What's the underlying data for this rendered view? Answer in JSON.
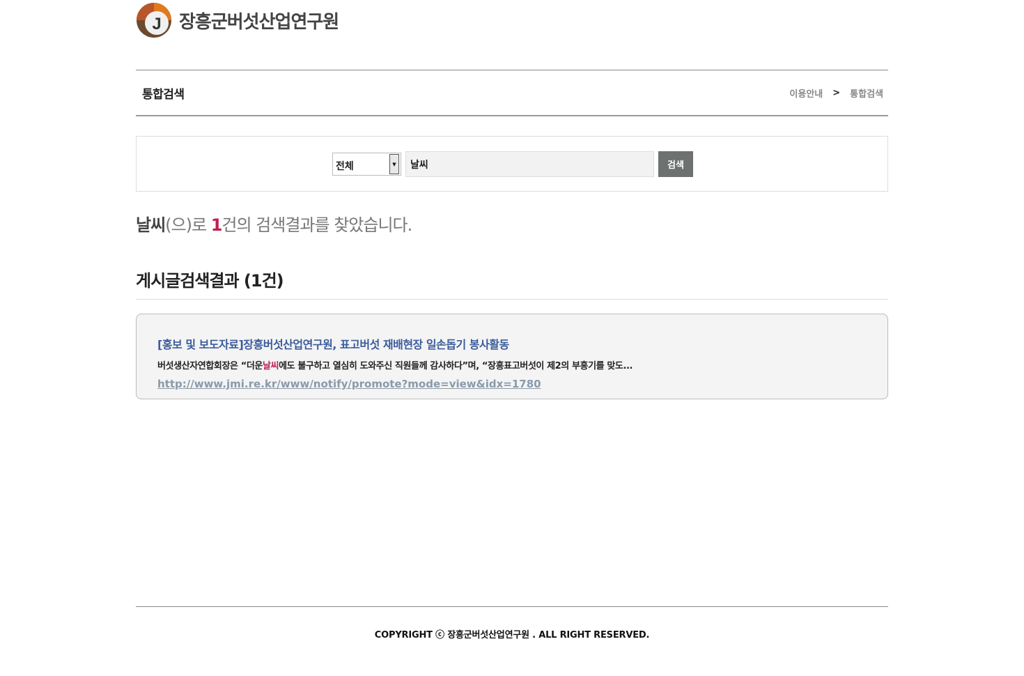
{
  "header": {
    "org_name": "장흥군버섯산업연구원",
    "logo_letter": "J"
  },
  "titlebar": {
    "page_title": "통합검색",
    "breadcrumb": {
      "parent": "이용안내",
      "separator": ">",
      "current": "통합검색"
    }
  },
  "search": {
    "category_selected": "전체",
    "query_value": "날씨",
    "button_label": "검색"
  },
  "summary": {
    "keyword": "날씨",
    "suffix1": "(으)로 ",
    "count": "1",
    "suffix2": "건의 검색결과를 찾았습니다."
  },
  "results_section": {
    "title": "게시글검색결과 (1건)",
    "items": [
      {
        "title": "[홍보 및 보도자료]장흥버섯산업연구원, 표고버섯 재배현장 일손돕기 봉사활동",
        "snippet_before": "버섯생산자연합회장은 “더운",
        "snippet_highlight": "날씨",
        "snippet_after": "에도 불구하고 열심히 도와주신 직원들께 감사하다”며, “장흥표고버섯이 제2의 부흥기를 맞도...",
        "url": "http://www.jmi.re.kr/www/notify/promote?mode=view&idx=1780"
      }
    ]
  },
  "footer": {
    "copyright": "COPYRIGHT ⓒ 장흥군버섯산업연구원 . ALL RIGHT RESERVED."
  },
  "colors": {
    "accent_red": "#c0204f",
    "link_blue": "#3b5c9c",
    "button_gray": "#6d716f",
    "logo_orange": "#e07a1f"
  }
}
